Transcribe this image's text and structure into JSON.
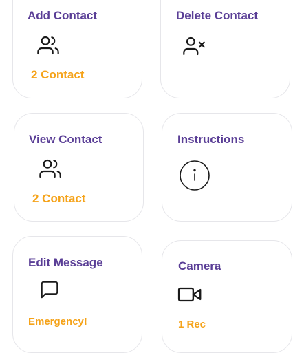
{
  "cards": [
    {
      "title": "Add Contact",
      "subtitle": "2 Contact",
      "icon": "users-icon"
    },
    {
      "title": "Delete Contact",
      "icon": "user-x-icon"
    },
    {
      "title": "View Contact",
      "subtitle": "2 Contact",
      "icon": "users-icon"
    },
    {
      "title": "Instructions",
      "icon": "info-icon"
    },
    {
      "title": "Edit Message",
      "subtitle": "Emergency!",
      "icon": "message-square-icon"
    },
    {
      "title": "Camera",
      "subtitle": "1 Rec",
      "icon": "video-icon"
    }
  ],
  "colors": {
    "title": "#5a3e96",
    "subtitle": "#f5a31a",
    "icon": "#1a1a1a",
    "card_border": "#e6e6ea"
  }
}
